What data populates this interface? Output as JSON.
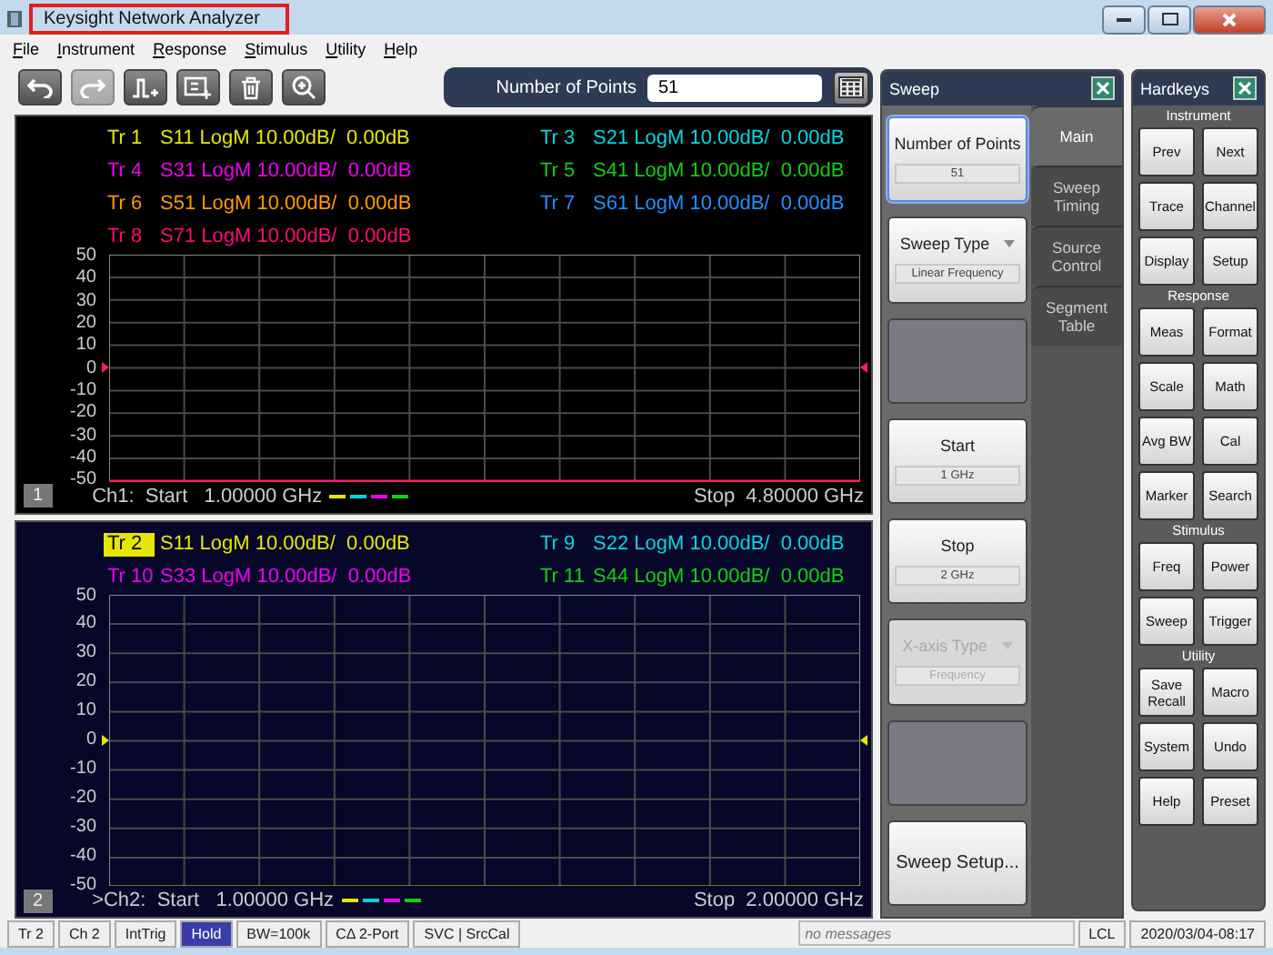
{
  "window": {
    "title": "Keysight Network Analyzer"
  },
  "menu": [
    "File",
    "Instrument",
    "Response",
    "Stimulus",
    "Utility",
    "Help"
  ],
  "toolbar": [
    {
      "kind": "undo",
      "disabled": false
    },
    {
      "kind": "redo",
      "disabled": true
    },
    {
      "kind": "add-trace",
      "disabled": false
    },
    {
      "kind": "add-channel",
      "disabled": false
    },
    {
      "kind": "delete",
      "disabled": false
    },
    {
      "kind": "zoom",
      "disabled": false
    }
  ],
  "entry": {
    "label": "Number of Points",
    "value": "51"
  },
  "channels": [
    {
      "number": "1",
      "active": false,
      "color": "#ff1a6a",
      "traces": [
        {
          "label": "Tr 1",
          "desc": "S11 LogM 10.00dB/  0.00dB",
          "color": "#e6e600",
          "selected": false
        },
        {
          "label": "Tr 3",
          "desc": "S21 LogM 10.00dB/  0.00dB",
          "color": "#00d8e0",
          "selected": false
        },
        {
          "label": "Tr 4",
          "desc": "S31 LogM 10.00dB/  0.00dB",
          "color": "#f000f0",
          "selected": false
        },
        {
          "label": "Tr 5",
          "desc": "S41 LogM 10.00dB/  0.00dB",
          "color": "#10d010",
          "selected": false
        },
        {
          "label": "Tr 6",
          "desc": "S51 LogM 10.00dB/  0.00dB",
          "color": "#ff9a00",
          "selected": false
        },
        {
          "label": "Tr 7",
          "desc": "S61 LogM 10.00dB/  0.00dB",
          "color": "#2090ff",
          "selected": false
        },
        {
          "label": "Tr 8",
          "desc": "S71 LogM 10.00dB/  0.00dB",
          "color": "#ff0a78",
          "selected": false
        }
      ],
      "y_ticks": [
        "50",
        "40",
        "30",
        "20",
        "10",
        "0",
        "-10",
        "-20",
        "-30",
        "-40",
        "-50"
      ],
      "start": "Ch1:  Start   1.00000 GHz",
      "stop": "Stop  4.80000 GHz",
      "legend": [
        {
          "color": "#e6e600"
        },
        {
          "color": "#00d8e0"
        },
        {
          "color": "#f000f0"
        },
        {
          "color": "#10d010"
        }
      ]
    },
    {
      "number": "2",
      "active": true,
      "color": "#e6e600",
      "traces": [
        {
          "label": "Tr 2",
          "desc": "S11 LogM 10.00dB/  0.00dB",
          "color": "#e6e600",
          "selected": true
        },
        {
          "label": "Tr 9",
          "desc": "S22 LogM 10.00dB/  0.00dB",
          "color": "#00d8e0",
          "selected": false
        },
        {
          "label": "Tr 10",
          "desc": "S33 LogM 10.00dB/  0.00dB",
          "color": "#f000f0",
          "selected": false
        },
        {
          "label": "Tr 11",
          "desc": "S44 LogM 10.00dB/  0.00dB",
          "color": "#10d010",
          "selected": false
        }
      ],
      "y_ticks": [
        "50",
        "40",
        "30",
        "20",
        "10",
        "0",
        "-10",
        "-20",
        "-30",
        "-40",
        "-50"
      ],
      "start": ">Ch2:  Start   1.00000 GHz",
      "stop": "Stop  2.00000 GHz",
      "legend": [
        {
          "color": "#e6e600"
        },
        {
          "color": "#00d8e0"
        },
        {
          "color": "#f000f0"
        },
        {
          "color": "#10d010"
        }
      ]
    }
  ],
  "sweep_panel": {
    "title": "Sweep",
    "controls": [
      {
        "kind": "value",
        "label": "Number of Points",
        "value": "51",
        "focused": true,
        "disabled": false
      },
      {
        "kind": "dropdown",
        "label": "Sweep Type",
        "value": "Linear Frequency",
        "focused": false,
        "disabled": false
      },
      {
        "kind": "blank"
      },
      {
        "kind": "value",
        "label": "Start",
        "value": "1 GHz",
        "focused": false,
        "disabled": false
      },
      {
        "kind": "value",
        "label": "Stop",
        "value": "2 GHz",
        "focused": false,
        "disabled": false
      },
      {
        "kind": "dropdown",
        "label": "X-axis Type",
        "value": "Frequency",
        "focused": false,
        "disabled": true
      },
      {
        "kind": "blank"
      },
      {
        "kind": "action",
        "label": "Sweep Setup...",
        "focused": false,
        "disabled": false
      }
    ],
    "tabs": [
      {
        "label": "Main",
        "selected": true
      },
      {
        "label": "Sweep Timing",
        "selected": false
      },
      {
        "label": "Source Control",
        "selected": false
      },
      {
        "label": "Segment Table",
        "selected": false
      }
    ]
  },
  "hardkeys": {
    "title": "Hardkeys",
    "groups": [
      {
        "heading": "Instrument",
        "keys": [
          "Prev",
          "Next",
          "Trace",
          "Channel",
          "Display",
          "Setup"
        ]
      },
      {
        "heading": "Response",
        "keys": [
          "Meas",
          "Format",
          "Scale",
          "Math",
          "Avg BW",
          "Cal",
          "Marker",
          "Search"
        ]
      },
      {
        "heading": "Stimulus",
        "keys": [
          "Freq",
          "Power",
          "Sweep",
          "Trigger"
        ]
      },
      {
        "heading": "Utility",
        "keys": [
          "Save Recall",
          "Macro",
          "System",
          "Undo",
          "Help",
          "Preset"
        ]
      }
    ]
  },
  "status_bar": {
    "items": [
      {
        "label": "Tr 2",
        "highlighted": false
      },
      {
        "label": "Ch 2",
        "highlighted": false
      },
      {
        "label": "IntTrig",
        "highlighted": false
      },
      {
        "label": "Hold",
        "highlighted": true
      },
      {
        "label": "BW=100k",
        "highlighted": false
      },
      {
        "label": "CΔ 2-Port",
        "highlighted": false
      },
      {
        "label": "SVC | SrcCal",
        "highlighted": false
      }
    ],
    "message": {
      "placeholder": "no messages"
    },
    "mode": "LCL",
    "clock": "2020/03/04-08:17"
  }
}
